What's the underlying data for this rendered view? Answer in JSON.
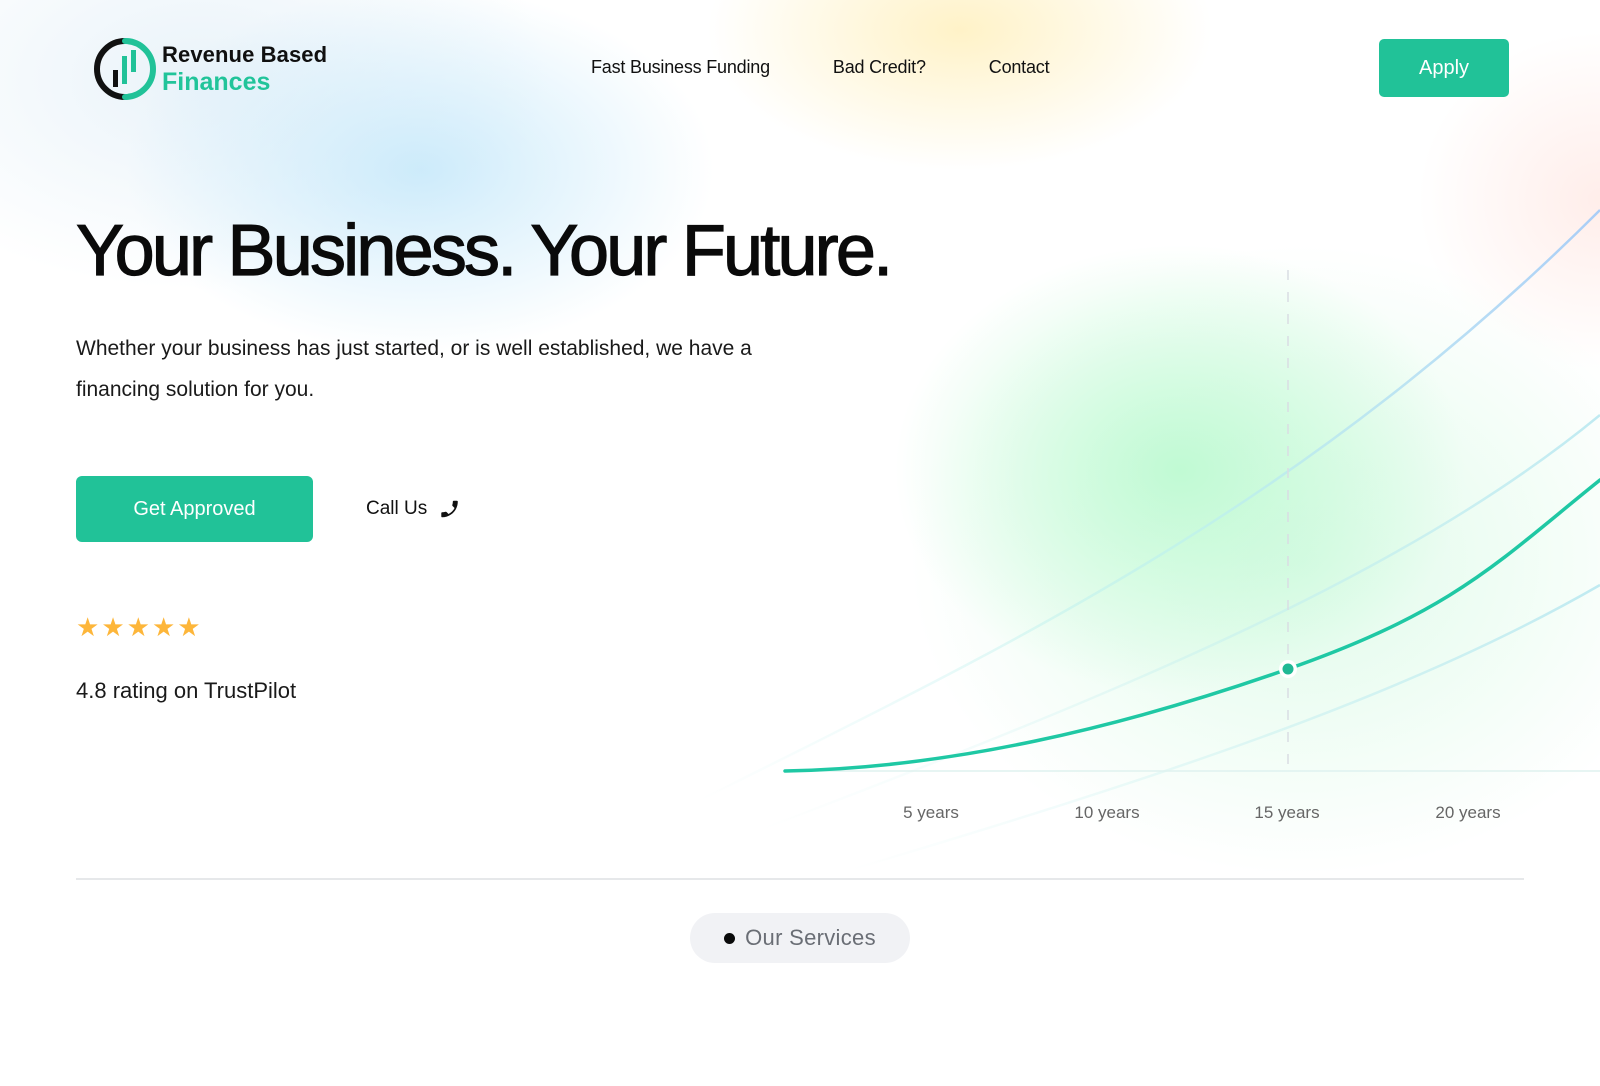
{
  "brand": {
    "line1": "Revenue Based",
    "line2": "Finances",
    "accent_color": "#21c298"
  },
  "nav": {
    "items": [
      {
        "label": "Fast Business Funding"
      },
      {
        "label": "Bad Credit?"
      },
      {
        "label": "Contact"
      }
    ],
    "apply_label": "Apply"
  },
  "hero": {
    "title": "Your Business. Your Future.",
    "subtitle": "Whether your business has just started, or is well established, we have a financing solution for you.",
    "primary_cta": "Get Approved",
    "secondary_cta": "Call Us",
    "secondary_cta_icon": "phone-icon"
  },
  "rating": {
    "stars": 5,
    "stars_max": 5,
    "star_color": "#fdb63a",
    "text": "4.8 rating on TrustPilot"
  },
  "growth_chart": {
    "x_labels": [
      "5 years",
      "10 years",
      "15 years",
      "20 years"
    ],
    "highlighted_label": "15 years",
    "line_color": "#1fc8a4"
  },
  "services": {
    "label": "Our Services"
  }
}
